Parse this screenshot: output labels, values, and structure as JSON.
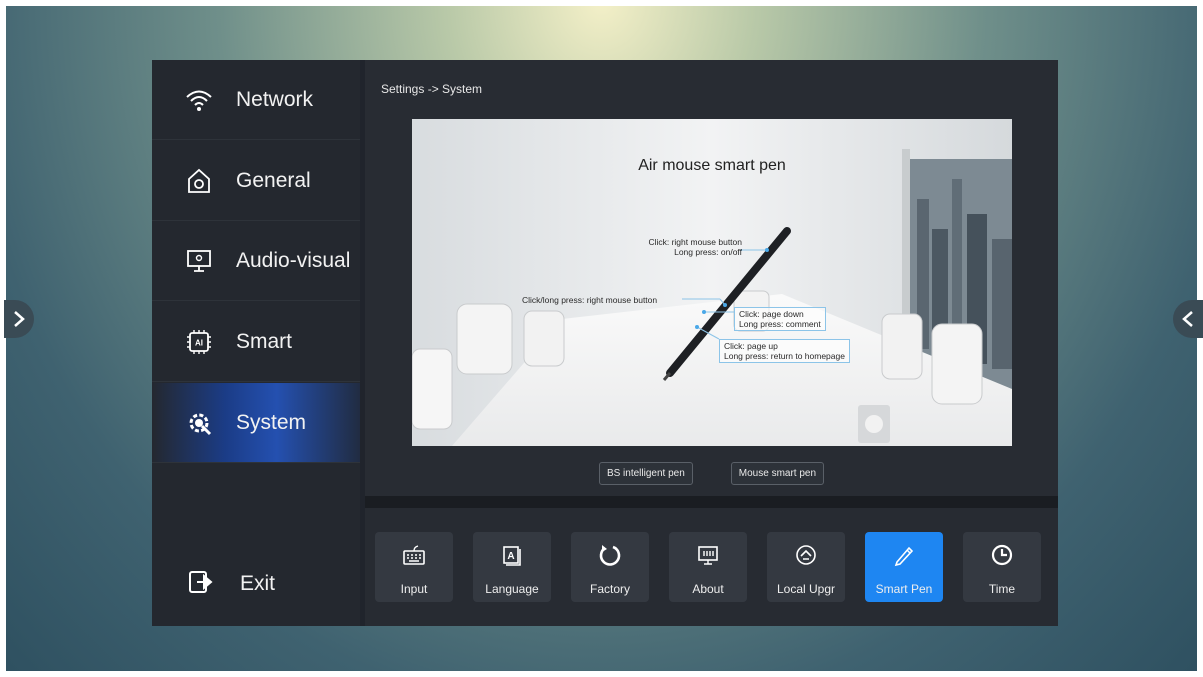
{
  "breadcrumb": "Settings -> System",
  "sidebar": {
    "items": [
      {
        "label": "Network",
        "icon": "wifi-icon"
      },
      {
        "label": "General",
        "icon": "gear-home-icon"
      },
      {
        "label": "Audio-visual",
        "icon": "monitor-icon"
      },
      {
        "label": "Smart",
        "icon": "ai-chip-icon"
      },
      {
        "label": "System",
        "icon": "system-gear-icon",
        "active": true
      }
    ],
    "exit_label": "Exit"
  },
  "preview": {
    "title": "Air mouse smart pen",
    "annotations": {
      "top_click": "Click: right mouse button",
      "top_long": "Long press: on/off",
      "side_click": "Click/long press: right mouse button",
      "mid_click": "Click: page down",
      "mid_long": "Long press: comment",
      "low_click": "Click: page up",
      "low_long": "Long press: return to homepage"
    }
  },
  "pen_tabs": [
    "BS intelligent pen",
    "Mouse smart pen"
  ],
  "toolbar": {
    "items": [
      {
        "label": "Input",
        "icon": "keyboard-icon"
      },
      {
        "label": "Language",
        "icon": "language-icon"
      },
      {
        "label": "Factory",
        "icon": "reset-icon"
      },
      {
        "label": "About",
        "icon": "about-icon"
      },
      {
        "label": "Local Upgr",
        "icon": "upgrade-icon"
      },
      {
        "label": "Smart Pen",
        "icon": "pen-icon",
        "active": true
      },
      {
        "label": "Time",
        "icon": "clock-icon"
      }
    ]
  },
  "colors": {
    "accent": "#1e86f2",
    "panel": "#20242c",
    "sidebar_active": "#2450b0"
  }
}
